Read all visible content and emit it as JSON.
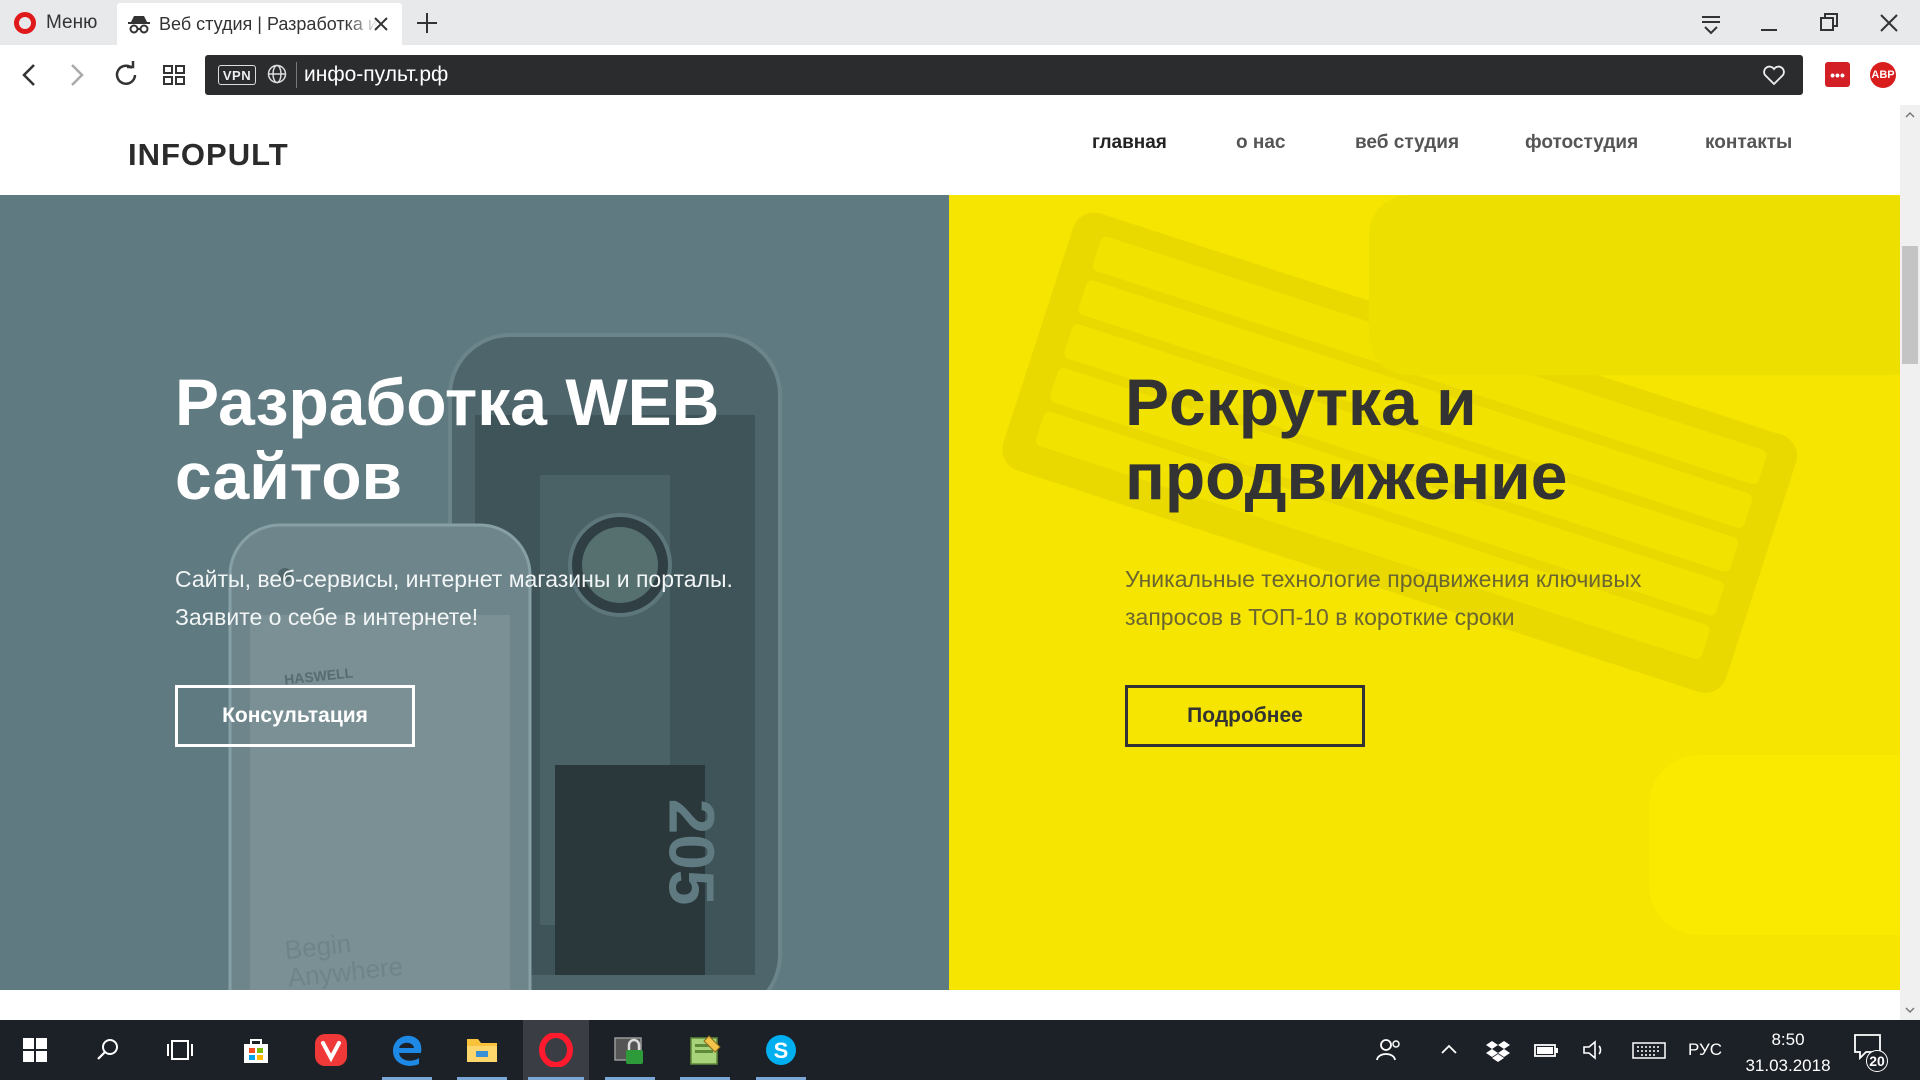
{
  "browser": {
    "menu_label": "Меню",
    "tab_title": "Веб студия | Разработка и продвижение",
    "url": "инфо-пульт.рф",
    "vpn_label": "VPN",
    "ext1_label": "•••",
    "ext2_label": "ABP",
    "icons": [
      "opera-logo-icon",
      "incognito-icon",
      "close-icon",
      "plus-icon",
      "tab-menu-icon",
      "minimize-icon",
      "restore-icon",
      "close-window-icon",
      "back-icon",
      "forward-icon",
      "reload-icon",
      "speed-dial-icon",
      "globe-icon",
      "heart-icon"
    ]
  },
  "site": {
    "logo": "INFOPULT",
    "nav": [
      {
        "label": "главная",
        "active": true
      },
      {
        "label": "о нас"
      },
      {
        "label": "веб студия"
      },
      {
        "label": "фотостудия"
      },
      {
        "label": "контакты"
      }
    ],
    "left": {
      "title_line1": "Разработка WEB",
      "title_line2": "сайтов",
      "text_line1": "Сайты, веб-сервисы, интернет магазины и порталы.",
      "text_line2": "Заявите о себе в интернете!",
      "button": "Консультация",
      "photo_caption_1": "Begin",
      "photo_caption_2": "Anywhere",
      "photo_brand": "HASWELL",
      "photo_number": "205"
    },
    "right": {
      "title_line1": "Рскрутка и",
      "title_line2": "продвижение",
      "text_line1": "Уникальные технологие продвижения ключивых",
      "text_line2": "запросов в ТОП-10 в короткие сроки",
      "button": "Подробнее"
    }
  },
  "colors": {
    "left_panel": "#5f7a80",
    "right_panel": "#f5e500",
    "urlbar": "#2b2c2e",
    "taskbar": "#1c2027"
  },
  "taskbar": {
    "apps": [
      "start-icon",
      "search-icon",
      "task-view-icon",
      "store-icon",
      "vivaldi-icon",
      "edge-icon",
      "explorer-icon",
      "opera-icon",
      "vpn-app-icon",
      "notepad-icon",
      "skype-icon"
    ],
    "lang": "РУС",
    "time": "8:50",
    "date": "31.03.2018",
    "notifications": "20"
  }
}
